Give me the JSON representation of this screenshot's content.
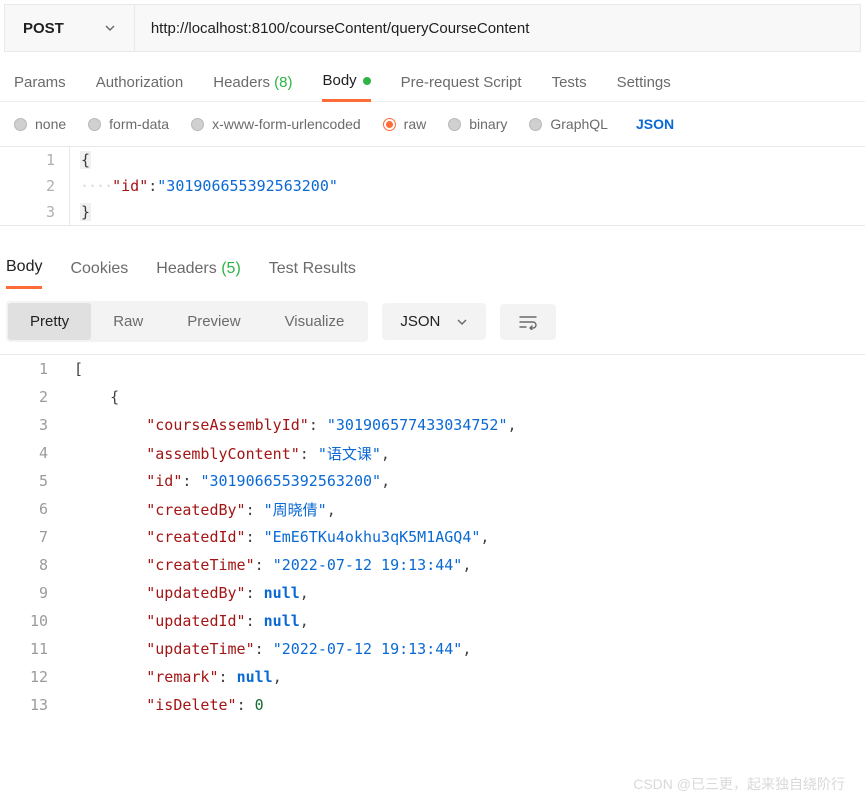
{
  "request": {
    "method": "POST",
    "url": "http://localhost:8100/courseContent/queryCourseContent"
  },
  "tabs": {
    "params": "Params",
    "authorization": "Authorization",
    "headers": "Headers",
    "headers_count": "(8)",
    "body": "Body",
    "prerequest": "Pre-request Script",
    "tests": "Tests",
    "settings": "Settings"
  },
  "body_types": {
    "none": "none",
    "form_data": "form-data",
    "xwww": "x-www-form-urlencoded",
    "raw": "raw",
    "binary": "binary",
    "graphql": "GraphQL",
    "lang": "JSON"
  },
  "request_body": {
    "line1": "{",
    "line2_key": "\"id\"",
    "line2_val": "\"301906655392563200\"",
    "line3": "}"
  },
  "resp_tabs": {
    "body": "Body",
    "cookies": "Cookies",
    "headers": "Headers",
    "headers_count": "(5)",
    "test_results": "Test Results"
  },
  "view": {
    "pretty": "Pretty",
    "raw": "Raw",
    "preview": "Preview",
    "visualize": "Visualize",
    "lang": "JSON"
  },
  "response_lines": [
    {
      "n": "1",
      "indent": 0,
      "type": "open",
      "text": "["
    },
    {
      "n": "2",
      "indent": 1,
      "type": "open",
      "text": "{"
    },
    {
      "n": "3",
      "indent": 2,
      "key": "\"courseAssemblyId\"",
      "vtype": "str",
      "val": "\"301906577433034752\"",
      "comma": true
    },
    {
      "n": "4",
      "indent": 2,
      "key": "\"assemblyContent\"",
      "vtype": "str",
      "val": "\"语文课\"",
      "comma": true
    },
    {
      "n": "5",
      "indent": 2,
      "key": "\"id\"",
      "vtype": "str",
      "val": "\"301906655392563200\"",
      "comma": true
    },
    {
      "n": "6",
      "indent": 2,
      "key": "\"createdBy\"",
      "vtype": "str",
      "val": "\"周晓倩\"",
      "comma": true
    },
    {
      "n": "7",
      "indent": 2,
      "key": "\"createdId\"",
      "vtype": "str",
      "val": "\"EmE6TKu4okhu3qK5M1AGQ4\"",
      "comma": true
    },
    {
      "n": "8",
      "indent": 2,
      "key": "\"createTime\"",
      "vtype": "str",
      "val": "\"2022-07-12 19:13:44\"",
      "comma": true
    },
    {
      "n": "9",
      "indent": 2,
      "key": "\"updatedBy\"",
      "vtype": "null",
      "val": "null",
      "comma": true
    },
    {
      "n": "10",
      "indent": 2,
      "key": "\"updatedId\"",
      "vtype": "null",
      "val": "null",
      "comma": true
    },
    {
      "n": "11",
      "indent": 2,
      "key": "\"updateTime\"",
      "vtype": "str",
      "val": "\"2022-07-12 19:13:44\"",
      "comma": true
    },
    {
      "n": "12",
      "indent": 2,
      "key": "\"remark\"",
      "vtype": "null",
      "val": "null",
      "comma": true
    },
    {
      "n": "13",
      "indent": 2,
      "key": "\"isDelete\"",
      "vtype": "num",
      "val": "0",
      "comma": false
    }
  ],
  "watermark": "CSDN @已三更，起来独自绕阶行"
}
